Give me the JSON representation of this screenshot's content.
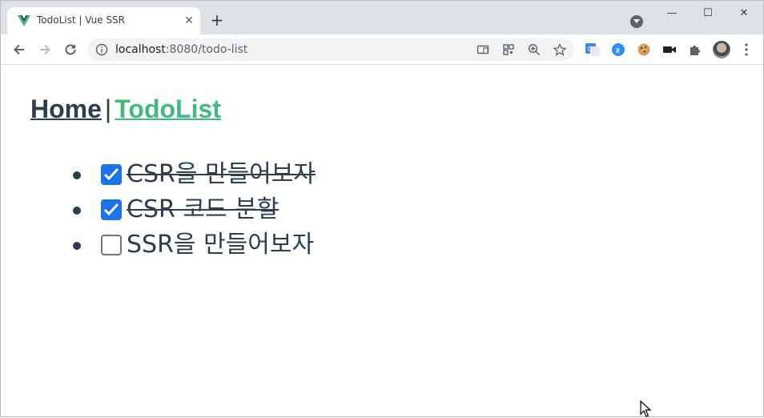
{
  "browser": {
    "tab": {
      "title": "TodoList | Vue SSR",
      "favicon": "vue-logo-icon",
      "close_glyph": "✕"
    },
    "new_tab_glyph": "+",
    "window_controls": {
      "minimize": "—",
      "maximize": "☐",
      "close": "✕"
    },
    "address": {
      "host": "localhost",
      "rest": ":8080/todo-list"
    },
    "colors": {
      "tab_strip": "#dee1e6",
      "omnibox": "#f1f3f4",
      "checkbox_checked": "#1a73e8"
    }
  },
  "app": {
    "nav": {
      "home_label": "Home",
      "separator": "|",
      "todolist_label": "TodoList"
    },
    "colors": {
      "text": "#2c3e50",
      "active_link": "#42b983"
    },
    "todos": [
      {
        "text": "CSR을 만들어보자",
        "done": true
      },
      {
        "text": "CSR 코드 분할",
        "done": true
      },
      {
        "text": "SSR을 만들어보자",
        "done": false
      }
    ]
  }
}
